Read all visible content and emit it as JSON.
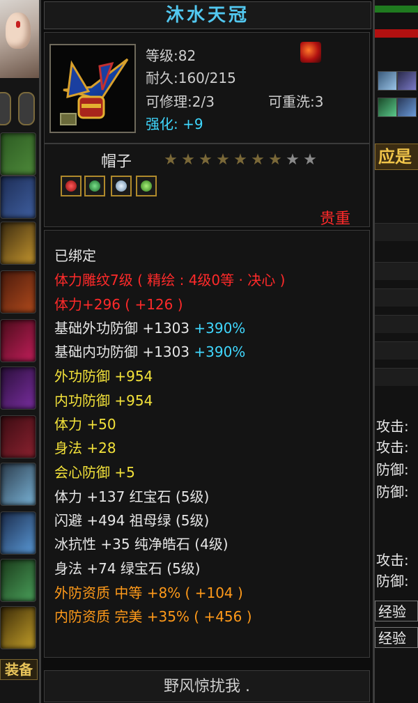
{
  "item": {
    "name": "沐水天冠",
    "level": "等级:82",
    "durability": "耐久:160/215",
    "repairable": "可修理:2/3",
    "rewashable": "可重洗:3",
    "enhance_label": "强化: ",
    "enhance_value": "+9",
    "type": "帽子",
    "stars_total": 9,
    "stars_lit": 7,
    "gems": [
      "ruby-gem",
      "emerald-gem",
      "white-gem",
      "green-gem"
    ],
    "rarity": "贵重"
  },
  "attributes": {
    "bound": "已绑定",
    "carve": "体力雕纹7级 ( 精绘 : 4级0等 · 决心 )",
    "stamina_main": "体力+296 ( +126 )",
    "base_ext_def": "基础外功防御 +1303",
    "base_ext_def_pct": "+390%",
    "base_int_def": "基础内功防御 +1303",
    "base_int_def_pct": "+390%",
    "ext_def": "外功防御  +954",
    "int_def": "内功防御  +954",
    "stamina": "体力  +50",
    "agility": "身法  +28",
    "crit_def": "会心防御  +5",
    "gem_stamina": "体力  +137  红宝石 (5级)",
    "gem_dodge": "闪避  +494  祖母绿 (5级)",
    "gem_ice": "冰抗性  +35  纯净皓石 (4级)",
    "gem_agility": "身法  +74  绿宝石 (5级)",
    "ext_quality": "外防资质    中等  +8% ( +104 )",
    "int_quality": "内防资质    完美  +35% ( +456 )"
  },
  "footer_text": "野风惊扰我 .",
  "left_panel": {
    "equip_label": "装备"
  },
  "right_panel": {
    "tab_label": "应是",
    "stats": [
      "攻击:",
      "攻击:",
      "防御:",
      "防御:",
      "攻击:",
      "防御:"
    ],
    "exp_labels": [
      "经验",
      "经验"
    ]
  },
  "colors": {
    "title": "#52c8f0",
    "red": "#ff2a2a",
    "yellow": "#f3e23a",
    "orange": "#ff9a1a",
    "cyan": "#40d8ff"
  }
}
